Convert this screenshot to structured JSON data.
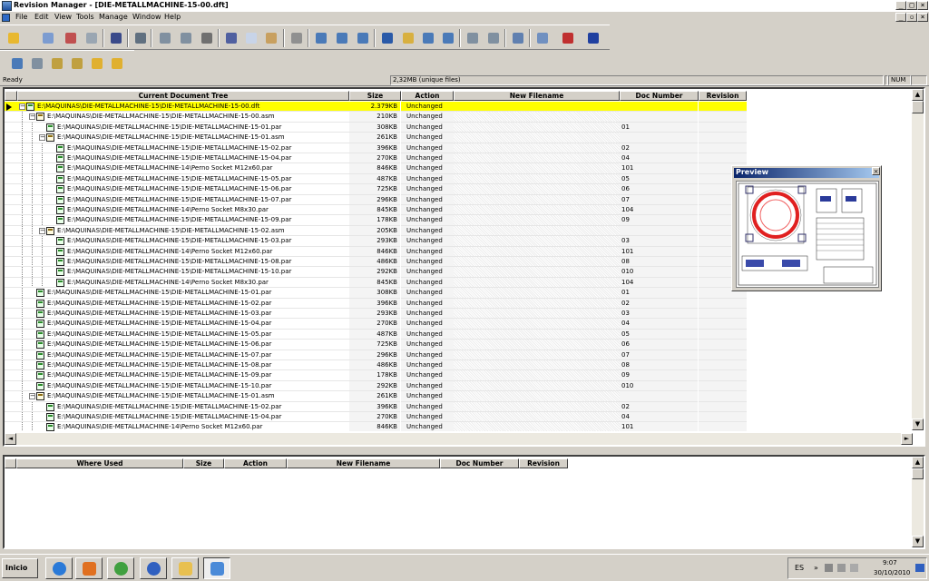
{
  "window": {
    "title": "Revision Manager - [DIE-METALLMACHINE-15-00.dft]",
    "controls": {
      "minimize": "_",
      "maximize": "□",
      "close": "×"
    },
    "mdi_controls": {
      "minimize": "_",
      "restore": "▫",
      "close": "×"
    }
  },
  "menu": [
    "File",
    "Edit",
    "View",
    "Tools",
    "Manage",
    "Window",
    "Help"
  ],
  "status": {
    "text": "Ready",
    "memory": "2,32MB (unique files)",
    "num": "NUM"
  },
  "tree": {
    "headers": {
      "name": "Current Document Tree",
      "size": "Size",
      "action": "Action",
      "newfile": "New Filename",
      "doc": "Doc Number",
      "rev": "Revision"
    },
    "rows": [
      {
        "name": "E:\\MAQUINAS\\DIE-METALLMACHINE-15\\DIE-METALLMACHINE-15-00.dft",
        "size": "2.379KB",
        "action": "Unchanged",
        "doc": ""
      },
      {
        "name": "E:\\MAQUINAS\\DIE-METALLMACHINE-15\\DIE-METALLMACHINE-15-00.asm",
        "size": "210KB",
        "action": "Unchanged",
        "doc": ""
      },
      {
        "name": "E:\\MAQUINAS\\DIE-METALLMACHINE-15\\DIE-METALLMACHINE-15-01.par",
        "size": "308KB",
        "action": "Unchanged",
        "doc": "01"
      },
      {
        "name": "E:\\MAQUINAS\\DIE-METALLMACHINE-15\\DIE-METALLMACHINE-15-01.asm",
        "size": "261KB",
        "action": "Unchanged",
        "doc": ""
      },
      {
        "name": "E:\\MAQUINAS\\DIE-METALLMACHINE-15\\DIE-METALLMACHINE-15-02.par",
        "size": "396KB",
        "action": "Unchanged",
        "doc": "02"
      },
      {
        "name": "E:\\MAQUINAS\\DIE-METALLMACHINE-15\\DIE-METALLMACHINE-15-04.par",
        "size": "270KB",
        "action": "Unchanged",
        "doc": "04"
      },
      {
        "name": "E:\\MAQUINAS\\DIE-METALLMACHINE-14\\Perno Socket M12x60.par",
        "size": "846KB",
        "action": "Unchanged",
        "doc": "101"
      },
      {
        "name": "E:\\MAQUINAS\\DIE-METALLMACHINE-15\\DIE-METALLMACHINE-15-05.par",
        "size": "487KB",
        "action": "Unchanged",
        "doc": "05"
      },
      {
        "name": "E:\\MAQUINAS\\DIE-METALLMACHINE-15\\DIE-METALLMACHINE-15-06.par",
        "size": "725KB",
        "action": "Unchanged",
        "doc": "06"
      },
      {
        "name": "E:\\MAQUINAS\\DIE-METALLMACHINE-15\\DIE-METALLMACHINE-15-07.par",
        "size": "296KB",
        "action": "Unchanged",
        "doc": "07"
      },
      {
        "name": "E:\\MAQUINAS\\DIE-METALLMACHINE-14\\Perno Socket M8x30.par",
        "size": "845KB",
        "action": "Unchanged",
        "doc": "104"
      },
      {
        "name": "E:\\MAQUINAS\\DIE-METALLMACHINE-15\\DIE-METALLMACHINE-15-09.par",
        "size": "178KB",
        "action": "Unchanged",
        "doc": "09"
      },
      {
        "name": "E:\\MAQUINAS\\DIE-METALLMACHINE-15\\DIE-METALLMACHINE-15-02.asm",
        "size": "205KB",
        "action": "Unchanged",
        "doc": ""
      },
      {
        "name": "E:\\MAQUINAS\\DIE-METALLMACHINE-15\\DIE-METALLMACHINE-15-03.par",
        "size": "293KB",
        "action": "Unchanged",
        "doc": "03"
      },
      {
        "name": "E:\\MAQUINAS\\DIE-METALLMACHINE-14\\Perno Socket M12x60.par",
        "size": "846KB",
        "action": "Unchanged",
        "doc": "101"
      },
      {
        "name": "E:\\MAQUINAS\\DIE-METALLMACHINE-15\\DIE-METALLMACHINE-15-08.par",
        "size": "486KB",
        "action": "Unchanged",
        "doc": "08"
      },
      {
        "name": "E:\\MAQUINAS\\DIE-METALLMACHINE-15\\DIE-METALLMACHINE-15-10.par",
        "size": "292KB",
        "action": "Unchanged",
        "doc": "010"
      },
      {
        "name": "E:\\MAQUINAS\\DIE-METALLMACHINE-14\\Perno Socket M8x30.par",
        "size": "845KB",
        "action": "Unchanged",
        "doc": "104"
      },
      {
        "name": "E:\\MAQUINAS\\DIE-METALLMACHINE-15\\DIE-METALLMACHINE-15-01.par",
        "size": "308KB",
        "action": "Unchanged",
        "doc": "01"
      },
      {
        "name": "E:\\MAQUINAS\\DIE-METALLMACHINE-15\\DIE-METALLMACHINE-15-02.par",
        "size": "396KB",
        "action": "Unchanged",
        "doc": "02"
      },
      {
        "name": "E:\\MAQUINAS\\DIE-METALLMACHINE-15\\DIE-METALLMACHINE-15-03.par",
        "size": "293KB",
        "action": "Unchanged",
        "doc": "03"
      },
      {
        "name": "E:\\MAQUINAS\\DIE-METALLMACHINE-15\\DIE-METALLMACHINE-15-04.par",
        "size": "270KB",
        "action": "Unchanged",
        "doc": "04"
      },
      {
        "name": "E:\\MAQUINAS\\DIE-METALLMACHINE-15\\DIE-METALLMACHINE-15-05.par",
        "size": "487KB",
        "action": "Unchanged",
        "doc": "05"
      },
      {
        "name": "E:\\MAQUINAS\\DIE-METALLMACHINE-15\\DIE-METALLMACHINE-15-06.par",
        "size": "725KB",
        "action": "Unchanged",
        "doc": "06"
      },
      {
        "name": "E:\\MAQUINAS\\DIE-METALLMACHINE-15\\DIE-METALLMACHINE-15-07.par",
        "size": "296KB",
        "action": "Unchanged",
        "doc": "07"
      },
      {
        "name": "E:\\MAQUINAS\\DIE-METALLMACHINE-15\\DIE-METALLMACHINE-15-08.par",
        "size": "486KB",
        "action": "Unchanged",
        "doc": "08"
      },
      {
        "name": "E:\\MAQUINAS\\DIE-METALLMACHINE-15\\DIE-METALLMACHINE-15-09.par",
        "size": "178KB",
        "action": "Unchanged",
        "doc": "09"
      },
      {
        "name": "E:\\MAQUINAS\\DIE-METALLMACHINE-15\\DIE-METALLMACHINE-15-10.par",
        "size": "292KB",
        "action": "Unchanged",
        "doc": "010"
      },
      {
        "name": "E:\\MAQUINAS\\DIE-METALLMACHINE-15\\DIE-METALLMACHINE-15-01.asm",
        "size": "261KB",
        "action": "Unchanged",
        "doc": ""
      },
      {
        "name": "E:\\MAQUINAS\\DIE-METALLMACHINE-15\\DIE-METALLMACHINE-15-02.par",
        "size": "396KB",
        "action": "Unchanged",
        "doc": "02"
      },
      {
        "name": "E:\\MAQUINAS\\DIE-METALLMACHINE-15\\DIE-METALLMACHINE-15-04.par",
        "size": "270KB",
        "action": "Unchanged",
        "doc": "04"
      },
      {
        "name": "E:\\MAQUINAS\\DIE-METALLMACHINE-14\\Perno Socket M12x60.par",
        "size": "846KB",
        "action": "Unchanged",
        "doc": "101"
      }
    ]
  },
  "preview": {
    "title": "Preview",
    "close": "×"
  },
  "where_used": {
    "headers": {
      "name": "Where Used",
      "size": "Size",
      "action": "Action",
      "newfile": "New Filename",
      "doc": "Doc Number",
      "rev": "Revision"
    }
  },
  "taskbar": {
    "start": "Inicio",
    "lang": "ES",
    "time": "9:07",
    "date": "30/10/2010"
  },
  "colors": {
    "highlight": "#ffff00",
    "titlebar": "#0a246a",
    "face": "#d4d0c8"
  }
}
